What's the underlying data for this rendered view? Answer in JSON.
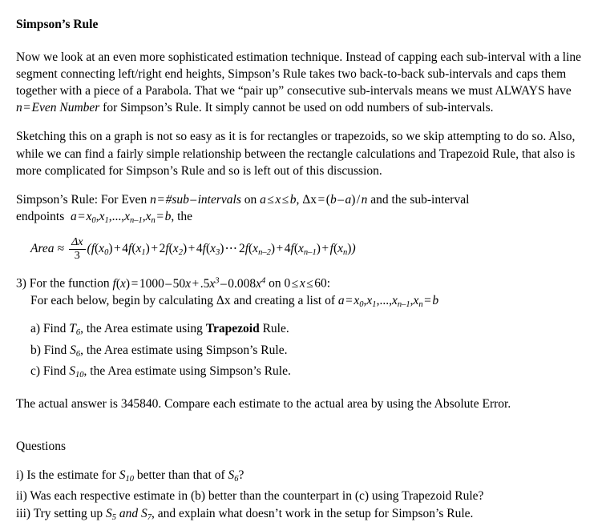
{
  "document": {
    "title": "Simpson’s Rule",
    "paragraphs": {
      "intro": "Now we look at an even more sophisticated estimation technique.  Instead of capping each sub-interval with a line segment connecting left/right end heights, Simpson’s Rule takes two back-to-back sub-intervals and caps them together with a piece of a Parabola.  That we “pair up” consecutive sub-intervals means we must ALWAYS have ",
      "intro_math_n": "n",
      "intro_math_eq": "=",
      "intro_math_even": "Even Number",
      "intro_tail": " for Simpson’s Rule.  It simply cannot be used on odd numbers of sub-intervals.",
      "sketching": "Sketching this on a graph is not so easy as it is for rectangles or trapezoids, so we skip attempting to do so.  Also, while we can find a fairly simple relationship between the rectangle calculations and Trapezoid Rule, that also is more complicated for Simpson’s Rule and so is left out of this discussion."
    },
    "definition": {
      "lead": "Simpson’s Rule:  For Even ",
      "n_var": "n",
      "eq1": "=",
      "hash_sub": "#sub",
      "minus": "–",
      "intervals_word": "intervals",
      "on_word": "on",
      "domain_a": "a",
      "le1": "≤",
      "domain_x": "x",
      "le2": "≤",
      "domain_b": "b",
      "comma1": ",",
      "delta_x": "Δx",
      "eq2": "=",
      "delta_rhs_open": "(",
      "delta_b": "b",
      "delta_minus": "–",
      "delta_a": "a",
      "delta_close": ")",
      "slash": "/",
      "delta_n": "n",
      "and_sub": " and the sub-interval",
      "endpoints_word": "endpoints",
      "endpoint_a": "a",
      "endpoint_eq": "=",
      "endpoint_x0": "x",
      "endpoint_x0_sub": "0",
      "endpoint_x1": "x",
      "endpoint_x1_sub": "1",
      "endpoint_dots": ",...,",
      "endpoint_xn1": "x",
      "endpoint_xn1_sub": "n–1",
      "endpoint_xn": "x",
      "endpoint_xn_sub": "n",
      "endpoint_eq2": "=",
      "endpoint_b": "b",
      "endpoint_tail": ", the"
    },
    "formula": {
      "area_label": "Area",
      "approx": "≈",
      "frac_num": "Δx",
      "frac_den": "3",
      "open_paren": "(",
      "terms": [
        {
          "coef": "",
          "fn": "f",
          "arg": "x",
          "sub": "0",
          "op_after": "+"
        },
        {
          "coef": "4",
          "fn": "f",
          "arg": "x",
          "sub": "1",
          "op_after": "+"
        },
        {
          "coef": "2",
          "fn": "f",
          "arg": "x",
          "sub": "2",
          "op_after": "+"
        },
        {
          "coef": "4",
          "fn": "f",
          "arg": "x",
          "sub": "3",
          "op_after": "⋯"
        },
        {
          "coef": "2",
          "fn": "f",
          "arg": "x",
          "sub": "n–2",
          "op_after": "+"
        },
        {
          "coef": "4",
          "fn": "f",
          "arg": "x",
          "sub": "n–1",
          "op_after": "+"
        },
        {
          "coef": "",
          "fn": "f",
          "arg": "x",
          "sub": "n",
          "op_after": ""
        }
      ],
      "close_paren": ")"
    },
    "problem": {
      "number": "3)",
      "lead": "For the function ",
      "fn_f": "f",
      "fn_open": "(",
      "fn_x": "x",
      "fn_close": ")",
      "fn_eq": "=",
      "c0": "1000",
      "m1": "–",
      "c1": "50",
      "v1": "x",
      "p1": "+",
      "c2": ".5",
      "v2": "x",
      "e2": "3",
      "m2": "–",
      "c3": "0.008",
      "v3": "x",
      "e3": "4",
      "on_word": "on",
      "dom_lo": "0",
      "dom_le1": "≤",
      "dom_x": "x",
      "dom_le2": "≤",
      "dom_hi": "60",
      "colon": ":",
      "sub_lead": "For each below, begin by calculating ",
      "delta_x": "Δx",
      "sub_mid": " and creating a list of ",
      "list_a": "a",
      "list_eq": "=",
      "list_x0": "x",
      "list_x0_sub": "0",
      "list_x1": "x",
      "list_x1_sub": "1",
      "list_dots": ",...,",
      "list_xn1": "x",
      "list_xn1_sub": "n–1",
      "list_xn": "x",
      "list_xn_sub": "n",
      "list_eq2": "=",
      "list_b": "b"
    },
    "tasks": [
      {
        "label": "a)",
        "find_word": "Find",
        "sym": "T",
        "sub": "6",
        "comma": ",",
        "mid": " the Area estimate using ",
        "rule_bold": "Trapezoid",
        "rule_plain": "",
        "tail": " Rule.",
        "bold_rule": true
      },
      {
        "label": "b)",
        "find_word": "Find",
        "sym": "S",
        "sub": "6",
        "comma": ",",
        "mid": " the Area estimate using ",
        "rule_bold": "",
        "rule_plain": "Simpson’s",
        "tail": " Rule.",
        "bold_rule": false
      },
      {
        "label": "c)",
        "find_word": "Find",
        "sym": "S",
        "sub": "10",
        "comma": ",",
        "mid": " the Area estimate using ",
        "rule_bold": "",
        "rule_plain": "Simpson’s",
        "tail": " Rule.",
        "bold_rule": false
      }
    ],
    "actual_answer_line": "The actual answer is 345840.  Compare each estimate to the actual area by using the Absolute Error.",
    "questions_heading": "Questions",
    "questions": [
      {
        "label": "i)",
        "pre": " Is the estimate for ",
        "sym1": "S",
        "sub1": "10",
        "mid": " better than that of ",
        "sym2": "S",
        "sub2": "6",
        "post": "?"
      },
      {
        "label": "ii)",
        "pre": " Was each respective estimate in (b) better than the counterpart in (c) using Trapezoid Rule?",
        "sym1": "",
        "sub1": "",
        "mid": "",
        "sym2": "",
        "sub2": "",
        "post": ""
      },
      {
        "label": "iii)",
        "pre": " Try setting up ",
        "sym1": "S",
        "sub1": "5",
        "mid": " and ",
        "sym2": "S",
        "sub2": "7",
        "post": ", and explain what doesn’t work in the setup for Simpson’s Rule."
      }
    ]
  }
}
